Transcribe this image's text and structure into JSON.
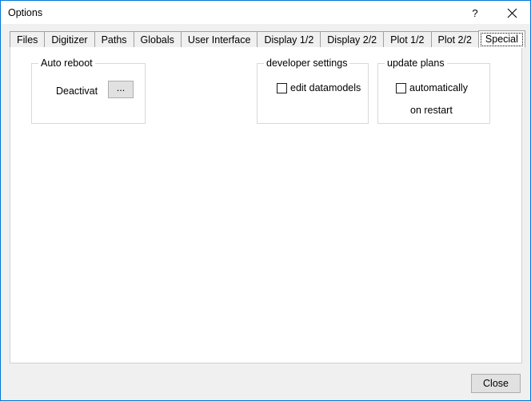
{
  "window": {
    "title": "Options",
    "accent_color": "#0078d7",
    "dialog_background": "#f0f0f0",
    "panel_background": "#ffffff"
  },
  "titlebar": {
    "help_button": "?",
    "close_button": "✕"
  },
  "tabs": [
    {
      "label": "Files",
      "selected": false
    },
    {
      "label": "Digitizer",
      "selected": false
    },
    {
      "label": "Paths",
      "selected": false
    },
    {
      "label": "Globals",
      "selected": false
    },
    {
      "label": "User Interface",
      "selected": false
    },
    {
      "label": "Display 1/2",
      "selected": false
    },
    {
      "label": "Display 2/2",
      "selected": false
    },
    {
      "label": "Plot 1/2",
      "selected": false
    },
    {
      "label": "Plot 2/2",
      "selected": false
    },
    {
      "label": "Special",
      "selected": true
    }
  ],
  "groups": {
    "auto_reboot": {
      "title": "Auto reboot",
      "deactivate_label": "Deactivat",
      "browse_button": "..."
    },
    "developer_settings": {
      "title": "developer settings",
      "edit_datamodels_label": "edit datamodels",
      "edit_datamodels_checked": false
    },
    "update_plans": {
      "title": "update plans",
      "automatically_label": "automatically",
      "automatically_checked": false,
      "on_restart_label": "on restart"
    }
  },
  "footer": {
    "close_label": "Close"
  }
}
